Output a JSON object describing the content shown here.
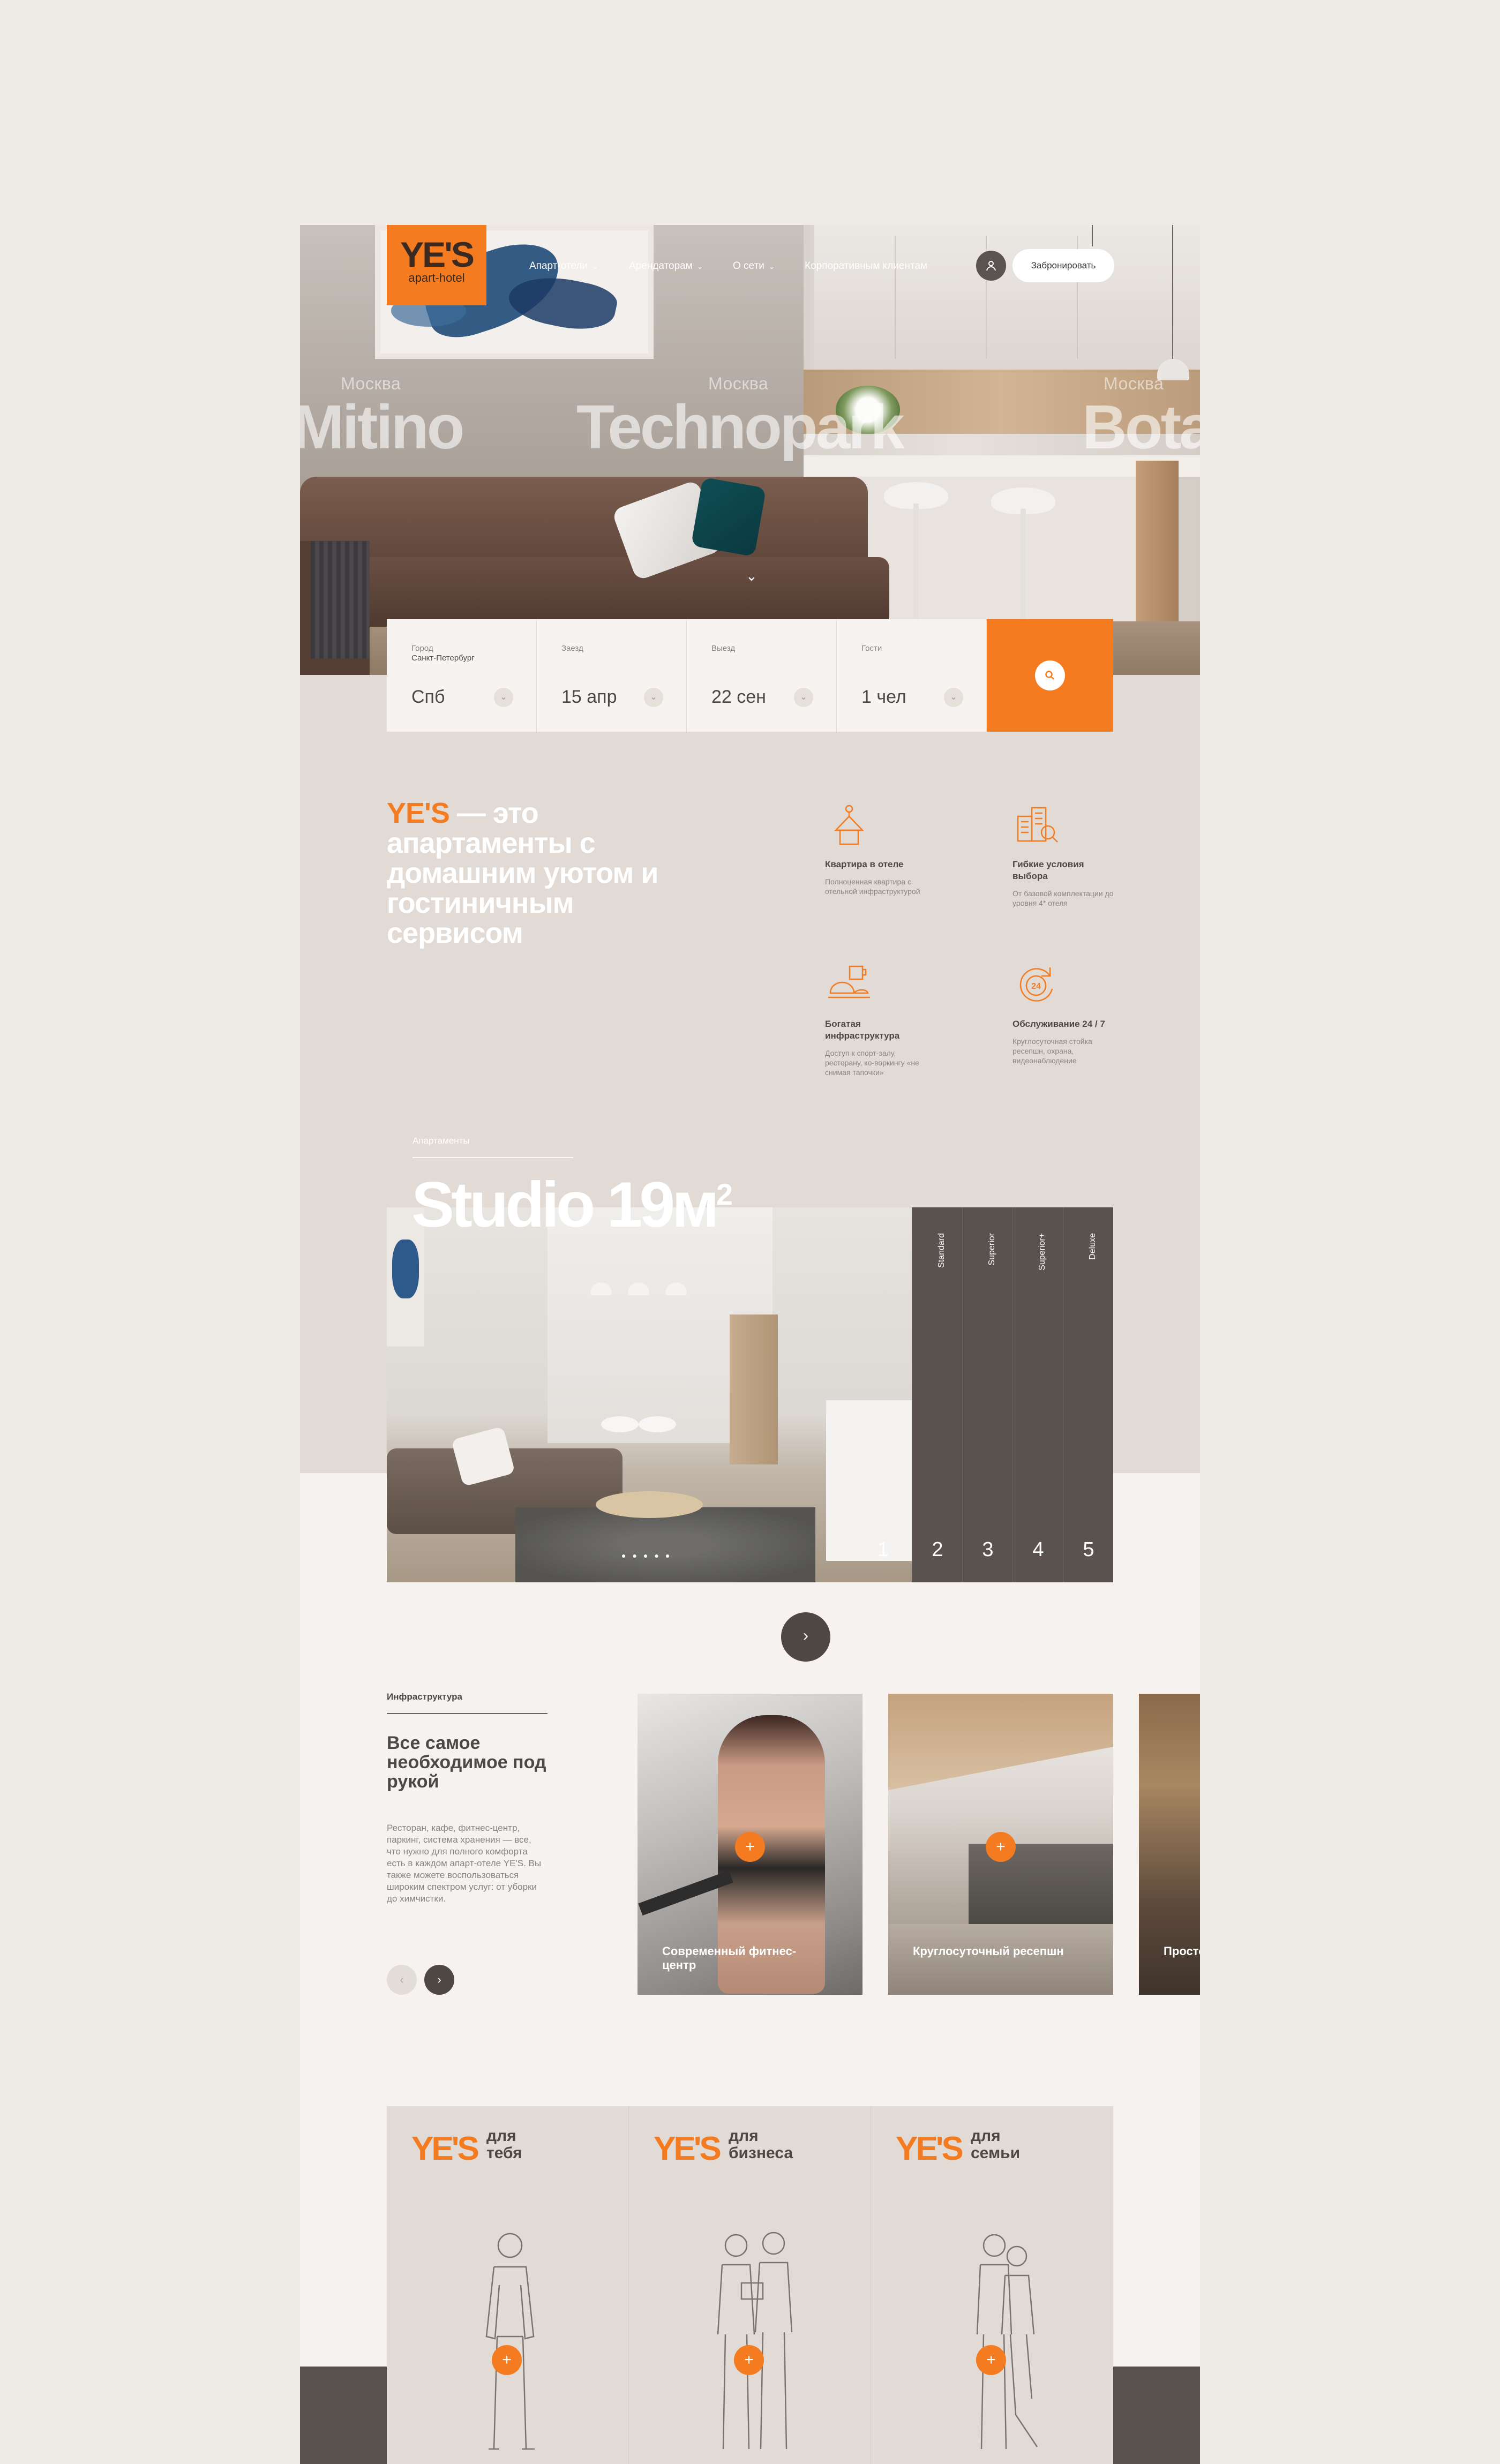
{
  "brand": {
    "logo_main": "YE'S",
    "logo_sub": "apart-hotel",
    "accent": "#f47b20"
  },
  "nav": {
    "items": [
      {
        "label": "Апарт-отели",
        "dropdown": true
      },
      {
        "label": "Арендаторам",
        "dropdown": true
      },
      {
        "label": "О сети",
        "dropdown": true
      },
      {
        "label": "Корпоративным клиентам",
        "dropdown": false
      }
    ],
    "user_icon": "user-icon",
    "book_label": "Забронировать"
  },
  "hero": {
    "hotels": [
      {
        "city": "Москва",
        "name": "Mitino"
      },
      {
        "city": "Москва",
        "name": "Technopark"
      },
      {
        "city": "Москва",
        "name": "Botanika"
      }
    ],
    "scroll_icon": "chevron-down-icon"
  },
  "booking": {
    "city": {
      "label": "Город",
      "sub": "Санкт-Петербург",
      "value": "Спб"
    },
    "checkin": {
      "label": "Заезд",
      "value": "15 апр"
    },
    "checkout": {
      "label": "Выезд",
      "value": "22 сен"
    },
    "guests": {
      "label": "Гости",
      "value": "1 чел"
    },
    "search_icon": "search-icon"
  },
  "about": {
    "title_brand": "YE'S",
    "title_rest": "— это апартаменты с домашним уютом и гостиничным сервисом",
    "features": [
      {
        "icon": "hanger-icon",
        "title": "Квартира в отеле",
        "desc": "Полноценная квартира с отельной инфраструктурой"
      },
      {
        "icon": "buildings-icon",
        "title": "Гибкие условия выбора",
        "desc": "От базовой комплектации до уровня 4* отеля"
      },
      {
        "icon": "coffee-icon",
        "title": "Богатая инфраструктура",
        "desc": "Доступ к спорт-залу, ресторану, ко-воркингу «не снимая тапочки»"
      },
      {
        "icon": "clock-24-icon",
        "title": "Обслуживание 24 / 7",
        "desc": "Круглосуточная стойка ресепшн, охрана, видеонаблюдение"
      }
    ]
  },
  "apartments": {
    "label": "Апартаменты",
    "title": "Studio 19м",
    "title_sup": "2",
    "current_number": "1",
    "tiers": [
      {
        "name": "Standard",
        "number": "2"
      },
      {
        "name": "Superior",
        "number": "3"
      },
      {
        "name": "Superior+",
        "number": "4"
      },
      {
        "name": "Deluxe",
        "number": "5"
      }
    ],
    "next_icon": "chevron-right-icon"
  },
  "infrastructure": {
    "label": "Инфраструктура",
    "title": "Все самое необходимое под рукой",
    "desc": "Ресторан, кафе, фитнес-центр, паркинг, система хранения — все, что нужно для полного комфорта есть в каждом апарт-отеле YE'S. Вы также можете воспользоваться широким спектром услуг: от уборки до химчистки.",
    "cards": [
      {
        "name": "Современный фитнес-центр"
      },
      {
        "name": "Круглосуточный ресепшн"
      },
      {
        "name": "Просторный ресторан"
      }
    ]
  },
  "segments": [
    {
      "brand": "YE'S",
      "for": "для тебя"
    },
    {
      "brand": "YE'S",
      "for": "для бизнеса"
    },
    {
      "brand": "YE'S",
      "for": "для семьи"
    }
  ]
}
